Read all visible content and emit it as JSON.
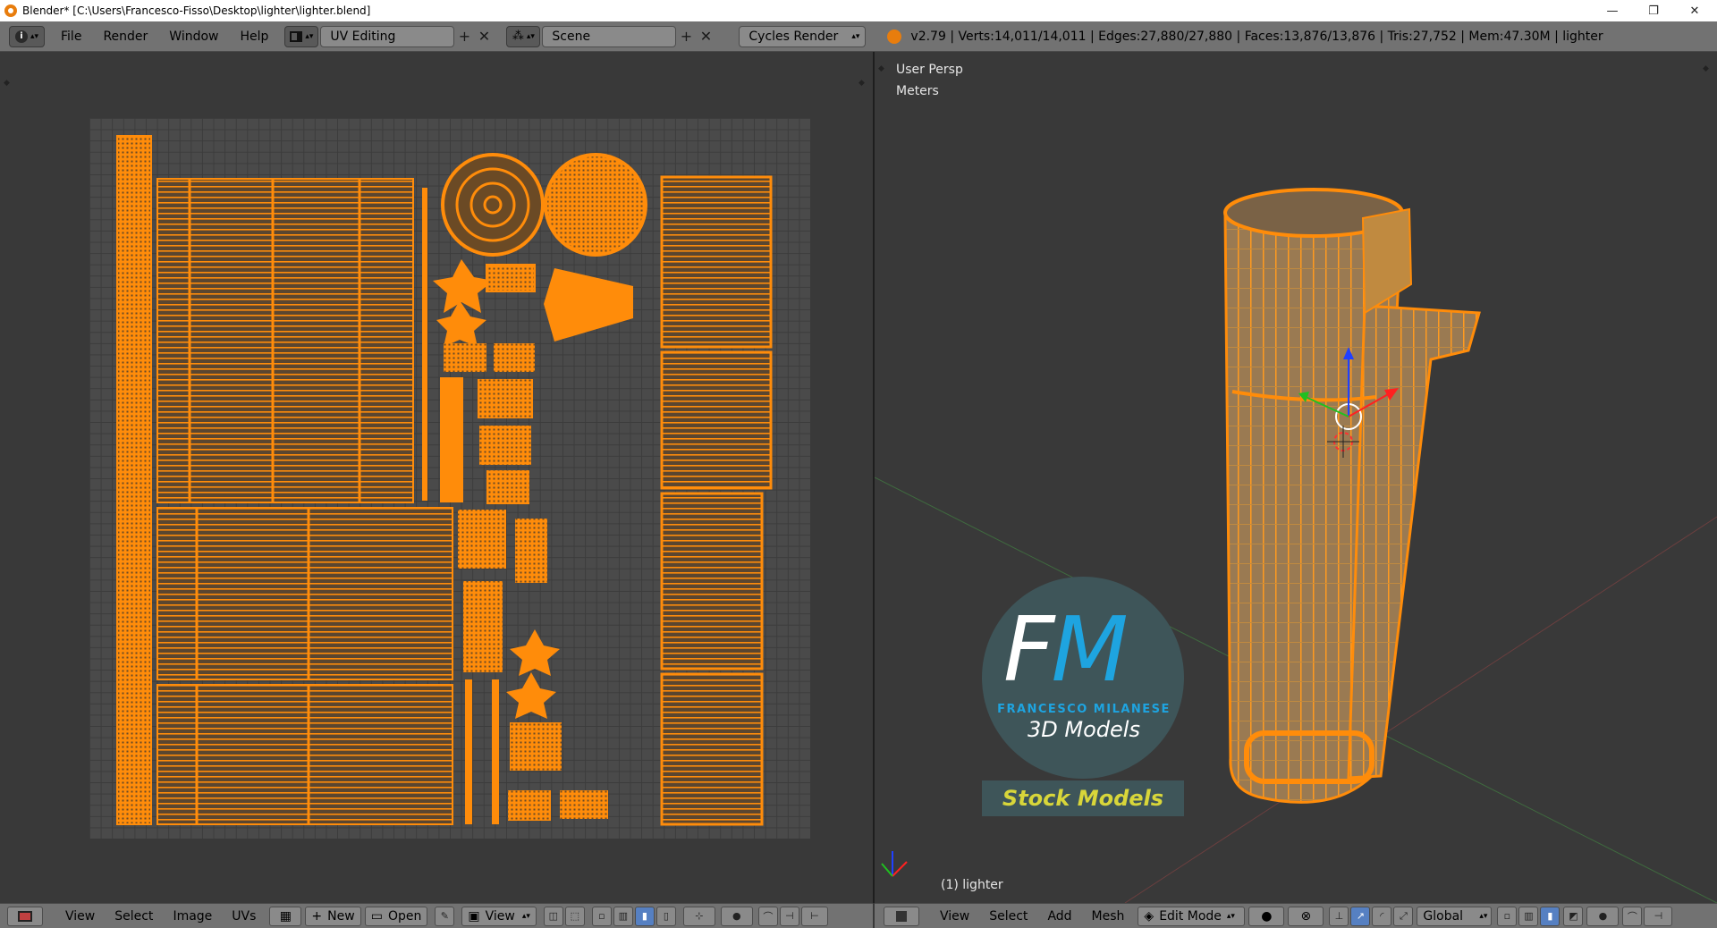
{
  "window": {
    "title": "Blender* [C:\\Users\\Francesco-Fisso\\Desktop\\lighter\\lighter.blend]",
    "minimize": "—",
    "restore": "❐",
    "close": "✕"
  },
  "menu": {
    "file": "File",
    "render": "Render",
    "window": "Window",
    "help": "Help"
  },
  "layout_field": "UV Editing",
  "scene_field": "Scene",
  "engine_field": "Cycles Render",
  "stats": "v2.79 | Verts:14,011/14,011 | Edges:27,880/27,880 | Faces:13,876/13,876 | Tris:27,752 | Mem:47.30M | lighter",
  "viewport": {
    "view_label": "User Persp",
    "units_label": "Meters",
    "object_label": "(1) lighter"
  },
  "logo": {
    "letters_f": "F",
    "letters_m": "M",
    "subtitle": "FRANCESCO MILANESE",
    "line2": "3D Models",
    "banner": "Stock Models"
  },
  "uv_header": {
    "view": "View",
    "select": "Select",
    "image": "Image",
    "uvs": "UVs",
    "new": "New",
    "open": "Open",
    "view2": "View"
  },
  "vp_header": {
    "view": "View",
    "select": "Select",
    "add": "Add",
    "mesh": "Mesh",
    "mode": "Edit Mode",
    "orientation": "Global"
  },
  "colors": {
    "uv_orange": "#ff8c0a",
    "header_grey": "#727272",
    "area_grey": "#393939",
    "logo_blue": "#1ea4e0",
    "logo_yellow": "#d8d63a"
  }
}
